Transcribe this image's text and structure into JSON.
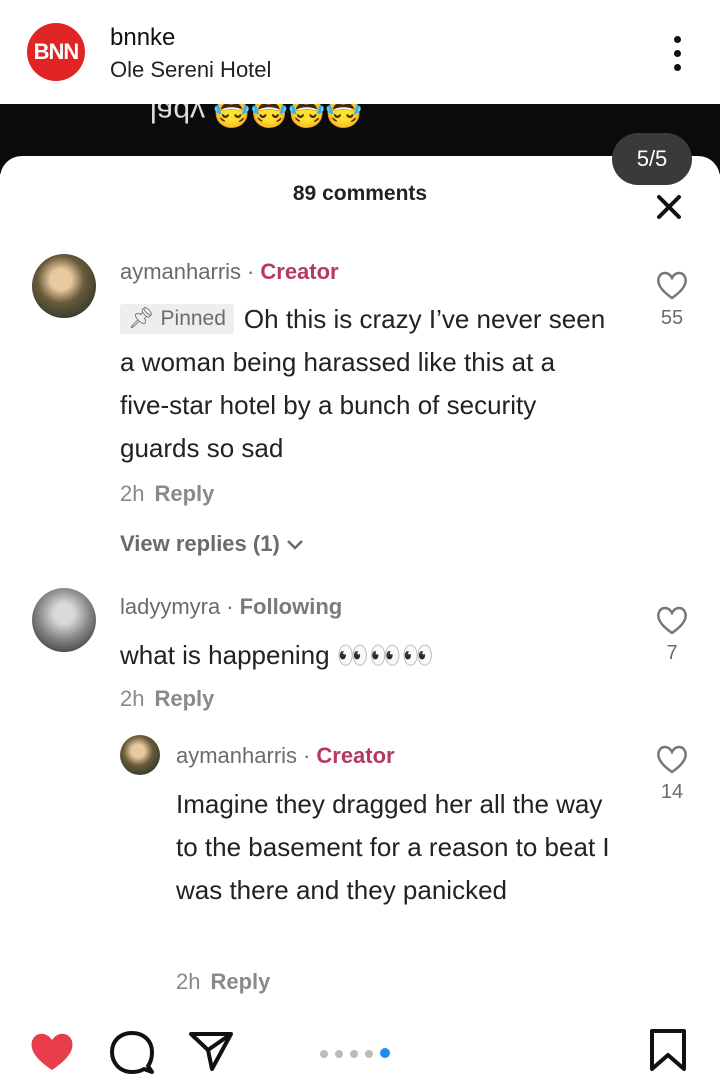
{
  "header": {
    "logo_text": "BNN",
    "account_name": "bnnke",
    "location": "Ole Sereni Hotel"
  },
  "video": {
    "caption_fragment": "lady 😂😂😂😂"
  },
  "sheet": {
    "page_indicator": "5/5",
    "comments_count": "89 comments"
  },
  "comments": [
    {
      "username": "aymanharris",
      "tag": "Creator",
      "pinned_label": "Pinned",
      "text": "Oh this is crazy I’ve never seen a woman being harassed like this at a five-star hotel by a bunch of security guards so sad",
      "time": "2h",
      "reply_label": "Reply",
      "likes": "55",
      "view_replies": "View replies (1)"
    },
    {
      "username": "ladyymyra",
      "tag": "Following",
      "text": "what is happening 👀👀👀",
      "time": "2h",
      "reply_label": "Reply",
      "likes": "7"
    },
    {
      "username": "aymanharris",
      "tag": "Creator",
      "text": "Imagine they dragged her all the way to the basement for a reason to beat I was there and they panicked",
      "time": "2h",
      "reply_label": "Reply",
      "likes": "14"
    }
  ],
  "bottom_bar": {
    "icons": [
      "heart-icon",
      "comment-icon",
      "share-icon",
      "bookmark-icon"
    ],
    "carousel_dots": 5,
    "carousel_active": 5,
    "colors": {
      "like": "#e83e4c",
      "active_dot": "#1d8cf0",
      "creator_tag": "#b43a5e"
    }
  }
}
